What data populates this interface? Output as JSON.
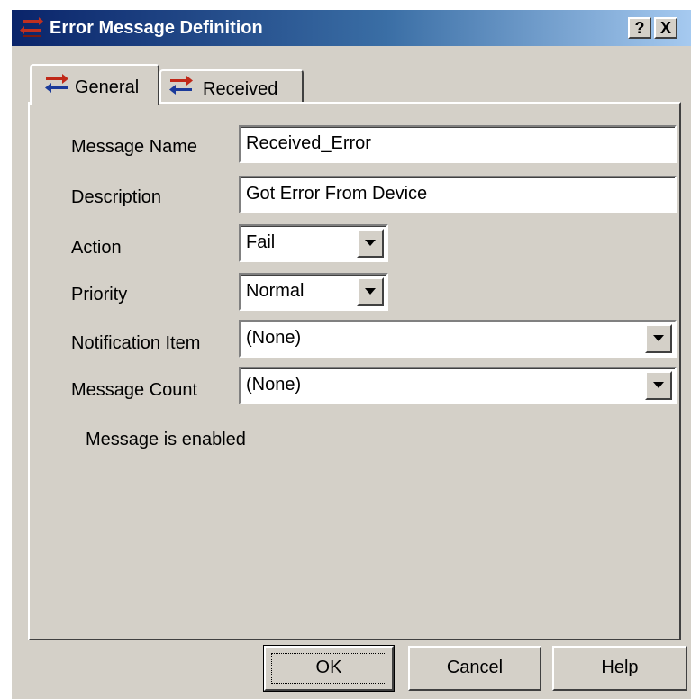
{
  "window": {
    "title": "Error Message Definition",
    "help_button": "?",
    "close_button": "X"
  },
  "tabs": [
    {
      "label": "General",
      "icon": "exchange-arrows-icon",
      "active": true
    },
    {
      "label": "Received",
      "icon": "exchange-arrows-icon",
      "active": false
    }
  ],
  "form": {
    "message_name": {
      "label": "Message Name",
      "value": "Received_Error"
    },
    "description": {
      "label": "Description",
      "value": "Got Error From Device"
    },
    "action": {
      "label": "Action",
      "value": "Fail"
    },
    "priority": {
      "label": "Priority",
      "value": "Normal"
    },
    "notification_item": {
      "label": "Notification Item",
      "value": "(None)"
    },
    "message_count": {
      "label": "Message Count",
      "value": "(None)"
    },
    "enabled": {
      "label": "Message is enabled",
      "checked": true
    }
  },
  "buttons": {
    "ok": "OK",
    "cancel": "Cancel",
    "help": "Help"
  },
  "colors": {
    "titlebar_start": "#0a246a",
    "titlebar_end": "#a6caf0",
    "face": "#d4d0c8"
  }
}
